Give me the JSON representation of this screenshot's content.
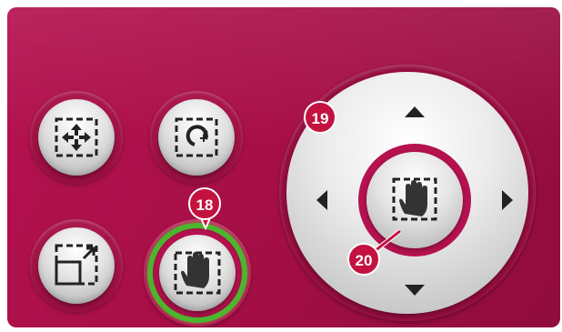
{
  "panel": {
    "background_color": "#a80f47",
    "accent_green": "#4cb52e"
  },
  "buttons": [
    {
      "name": "move-button",
      "icon": "move-arrows-icon",
      "active": false
    },
    {
      "name": "rotate-button",
      "icon": "rotate-icon",
      "active": false
    },
    {
      "name": "resize-button",
      "icon": "resize-icon",
      "active": false
    },
    {
      "name": "pan-button",
      "icon": "hand-icon",
      "active": true
    }
  ],
  "dpad": {
    "arrows": [
      "up",
      "down",
      "left",
      "right"
    ],
    "center_icon": "hand-icon"
  },
  "callouts": {
    "c18": "18",
    "c19": "19",
    "c20": "20"
  }
}
